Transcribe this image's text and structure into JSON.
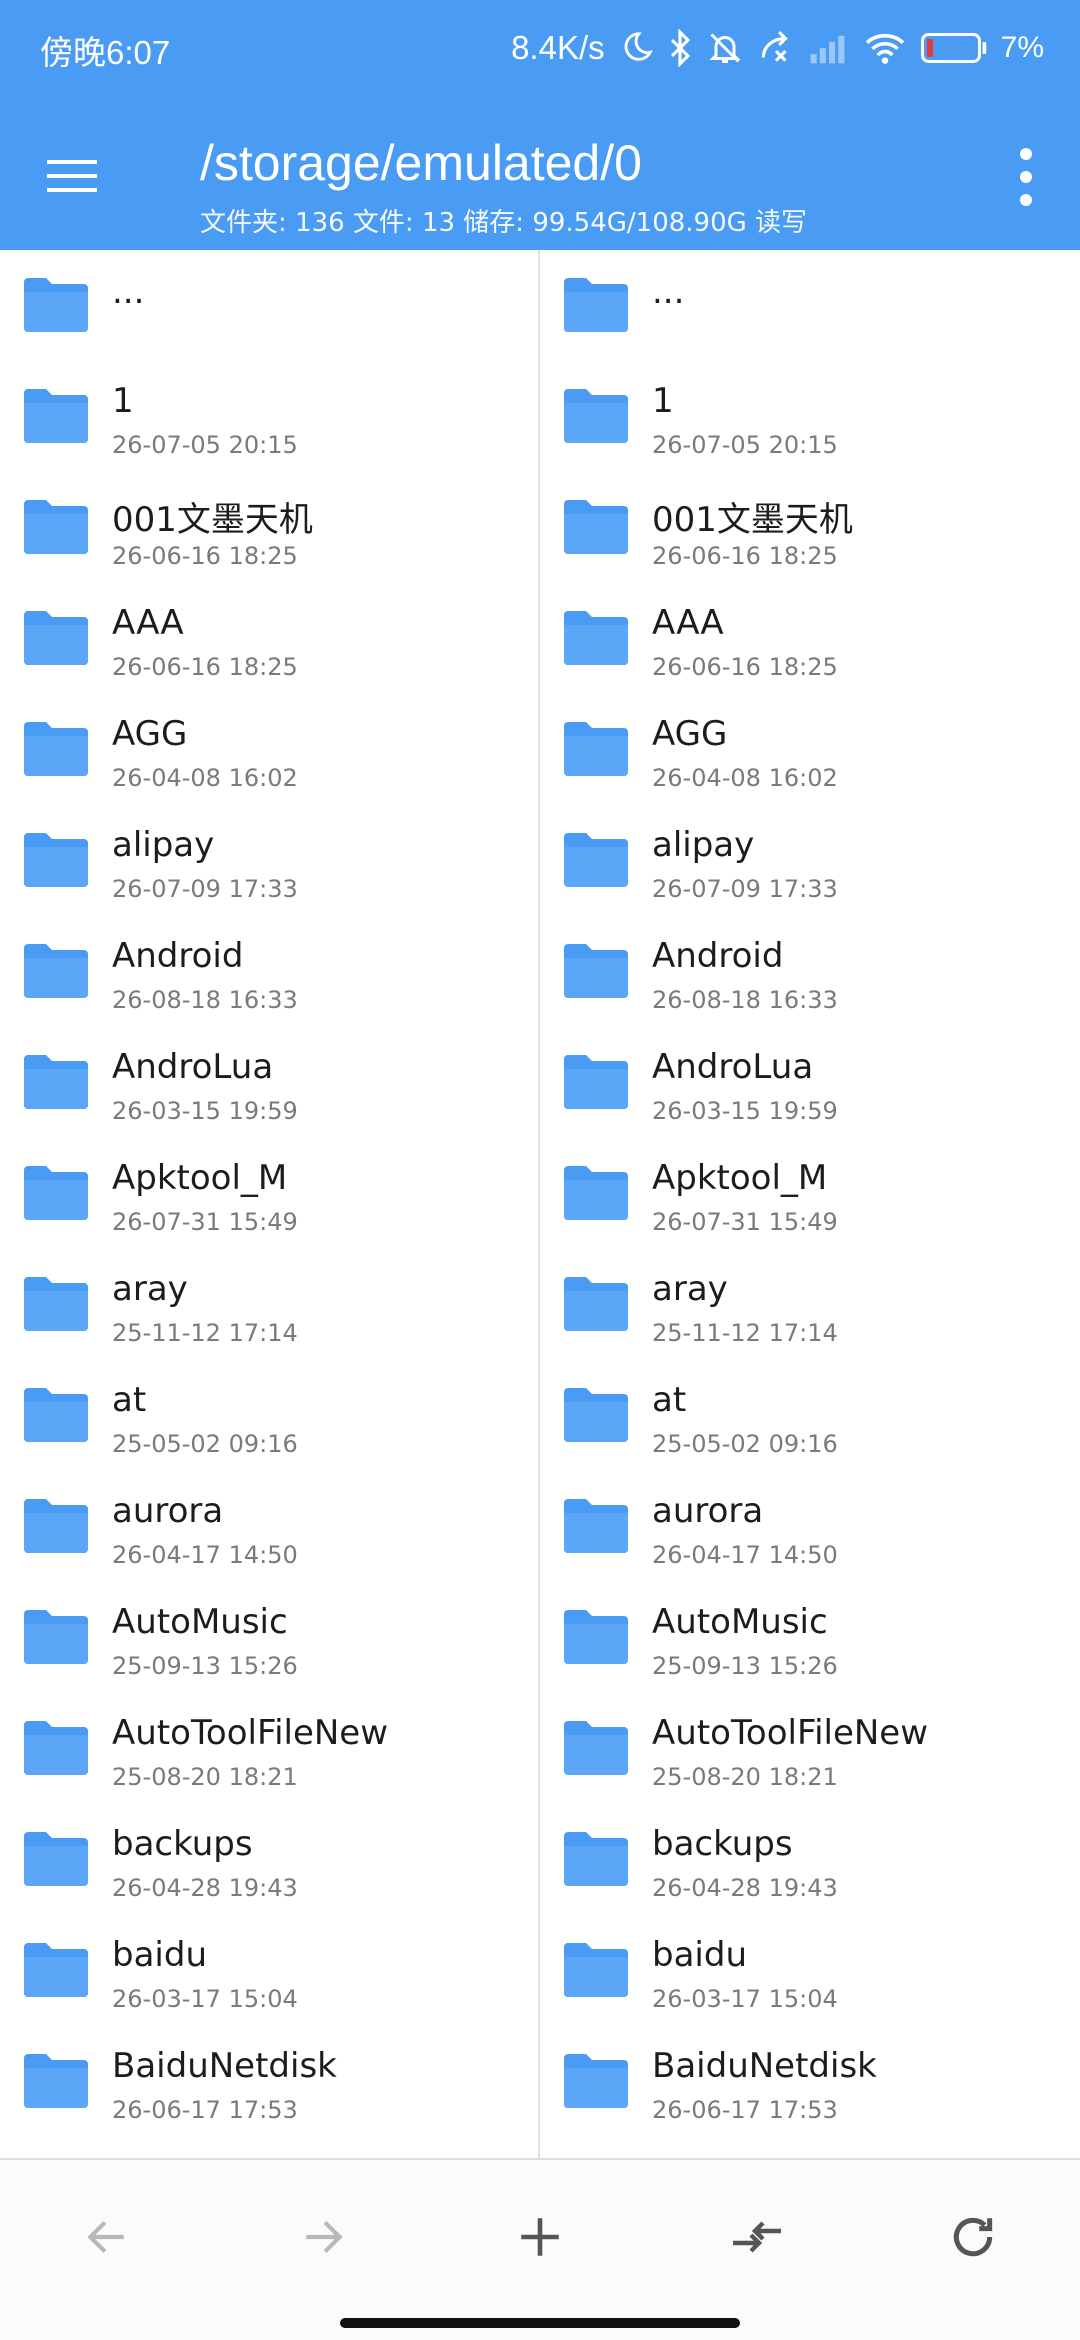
{
  "status_bar": {
    "time": "傍晚6:07",
    "net_speed": "8.4K/s",
    "battery": "7%"
  },
  "toolbar": {
    "path": "/storage/emulated/0",
    "info": "文件夹: 136  文件: 13  储存: 99.54G/108.90G    读写",
    "menu_icon": "hamburger-icon",
    "more_icon": "more-vertical-icon"
  },
  "panes": {
    "left": {
      "parent": "...",
      "items": [
        {
          "name": "1",
          "date": "26-07-05 20:15"
        },
        {
          "name": "001文墨天机",
          "date": "26-06-16 18:25"
        },
        {
          "name": "AAA",
          "date": "26-06-16 18:25"
        },
        {
          "name": "AGG",
          "date": "26-04-08 16:02"
        },
        {
          "name": "alipay",
          "date": "26-07-09 17:33"
        },
        {
          "name": "Android",
          "date": "26-08-18 16:33"
        },
        {
          "name": "AndroLua",
          "date": "26-03-15 19:59"
        },
        {
          "name": "Apktool_M",
          "date": "26-07-31 15:49"
        },
        {
          "name": "aray",
          "date": "25-11-12 17:14"
        },
        {
          "name": "at",
          "date": "25-05-02 09:16"
        },
        {
          "name": "aurora",
          "date": "26-04-17 14:50"
        },
        {
          "name": "AutoMusic",
          "date": "25-09-13 15:26"
        },
        {
          "name": "AutoToolFileNew",
          "date": "25-08-20 18:21"
        },
        {
          "name": "backups",
          "date": "26-04-28 19:43"
        },
        {
          "name": "baidu",
          "date": "26-03-17 15:04"
        },
        {
          "name": "BaiduNetdisk",
          "date": "26-06-17 17:53"
        }
      ]
    },
    "right": {
      "parent": "...",
      "items": [
        {
          "name": "1",
          "date": "26-07-05 20:15"
        },
        {
          "name": "001文墨天机",
          "date": "26-06-16 18:25"
        },
        {
          "name": "AAA",
          "date": "26-06-16 18:25"
        },
        {
          "name": "AGG",
          "date": "26-04-08 16:02"
        },
        {
          "name": "alipay",
          "date": "26-07-09 17:33"
        },
        {
          "name": "Android",
          "date": "26-08-18 16:33"
        },
        {
          "name": "AndroLua",
          "date": "26-03-15 19:59"
        },
        {
          "name": "Apktool_M",
          "date": "26-07-31 15:49"
        },
        {
          "name": "aray",
          "date": "25-11-12 17:14"
        },
        {
          "name": "at",
          "date": "25-05-02 09:16"
        },
        {
          "name": "aurora",
          "date": "26-04-17 14:50"
        },
        {
          "name": "AutoMusic",
          "date": "25-09-13 15:26"
        },
        {
          "name": "AutoToolFileNew",
          "date": "25-08-20 18:21"
        },
        {
          "name": "backups",
          "date": "26-04-28 19:43"
        },
        {
          "name": "baidu",
          "date": "26-03-17 15:04"
        },
        {
          "name": "BaiduNetdisk",
          "date": "26-06-17 17:53"
        }
      ]
    }
  },
  "bottom_bar": {
    "buttons": [
      "back-arrow-icon",
      "forward-arrow-icon",
      "add-icon",
      "swap-panes-icon",
      "refresh-icon"
    ]
  },
  "colors": {
    "accent": "#4a9bf4",
    "folder": "#4a9bf4",
    "disabled_icon": "#b8b8b8",
    "active_icon": "#555555"
  }
}
